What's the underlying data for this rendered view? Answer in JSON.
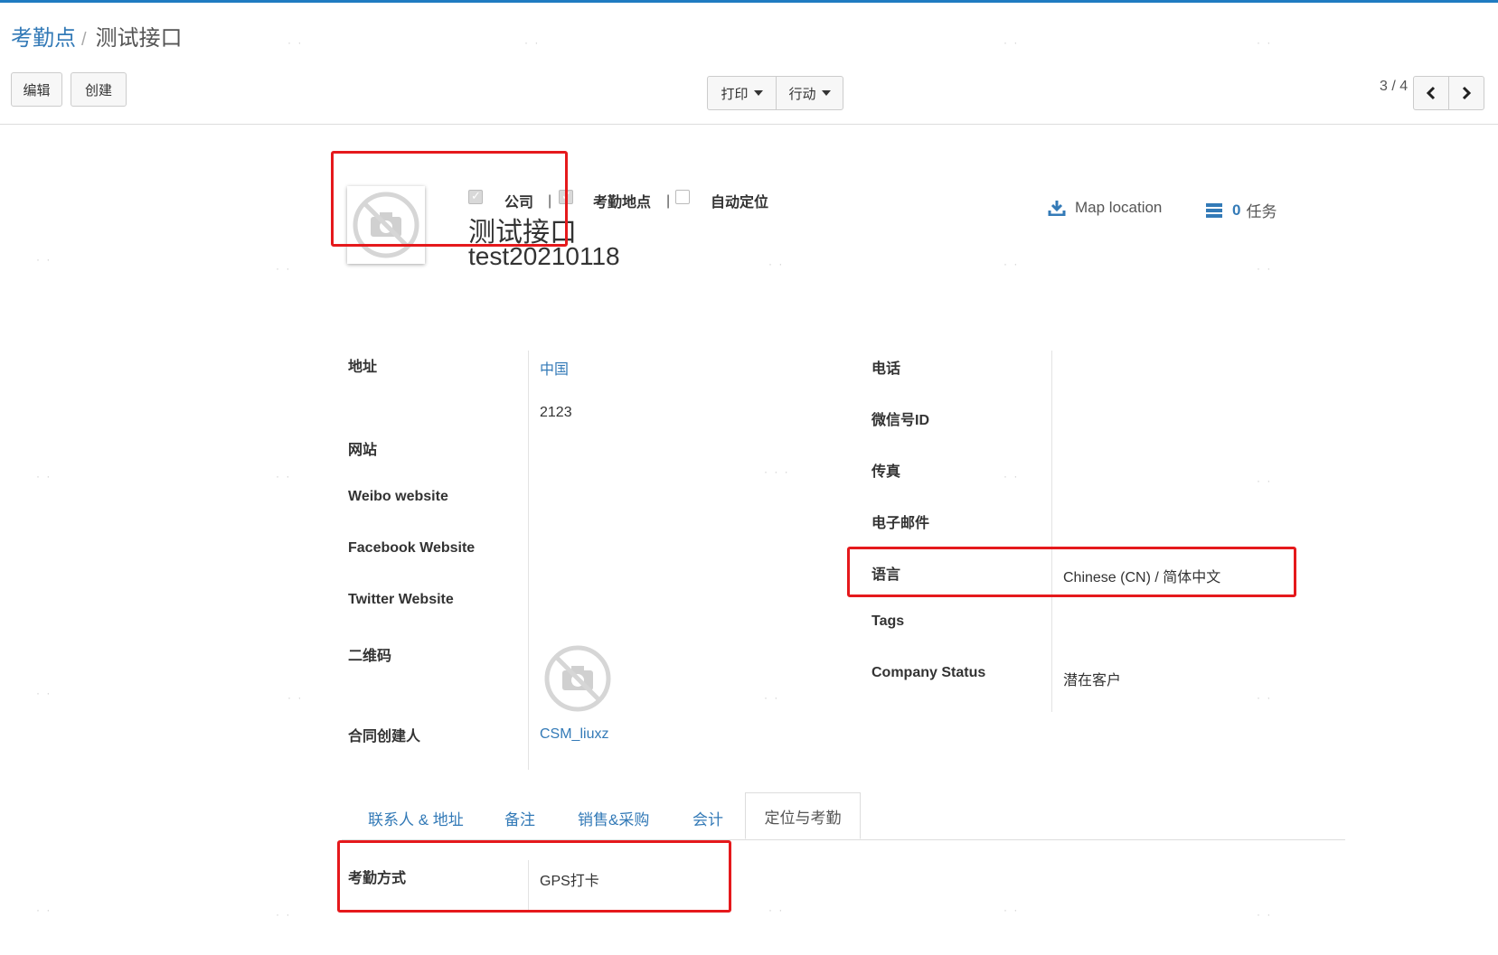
{
  "breadcrumb": {
    "parent": "考勤点",
    "separator": "/",
    "current": "测试接口"
  },
  "toolbar": {
    "edit_label": "编辑",
    "create_label": "创建",
    "print_label": "打印",
    "action_label": "行动",
    "pager": "3 / 4"
  },
  "record": {
    "flags": [
      {
        "label": "公司",
        "checked": true
      },
      {
        "label": "考勤地点",
        "checked": true
      },
      {
        "label": "自动定位",
        "checked": false
      }
    ],
    "flag_separator": "|",
    "name": "测试接口",
    "ref": "test20210118"
  },
  "smart_buttons": {
    "map_label": "Map location",
    "tasks_count": "0",
    "tasks_label": "任务"
  },
  "left_fields": {
    "address_label": "地址",
    "address_country": "中国",
    "address_line": "2123",
    "website_label": "网站",
    "weibo_label": "Weibo website",
    "facebook_label": "Facebook Website",
    "twitter_label": "Twitter Website",
    "qrcode_label": "二维码",
    "creator_label": "合同创建人",
    "creator_value": "CSM_liuxz"
  },
  "right_fields": {
    "phone_label": "电话",
    "wechat_label": "微信号ID",
    "fax_label": "传真",
    "email_label": "电子邮件",
    "language_label": "语言",
    "language_value": "Chinese (CN) / 简体中文",
    "tags_label": "Tags",
    "status_label": "Company Status",
    "status_value": "潜在客户"
  },
  "tabs": [
    {
      "label": "联系人 & 地址"
    },
    {
      "label": "备注"
    },
    {
      "label": "销售&采购"
    },
    {
      "label": "会计"
    },
    {
      "label": "定位与考勤",
      "active": true
    }
  ],
  "attendance": {
    "method_label": "考勤方式",
    "method_value": "GPS打卡"
  },
  "colors": {
    "accent": "#337ab7",
    "highlight": "#e5191c",
    "topbar": "#1f7bc1"
  }
}
